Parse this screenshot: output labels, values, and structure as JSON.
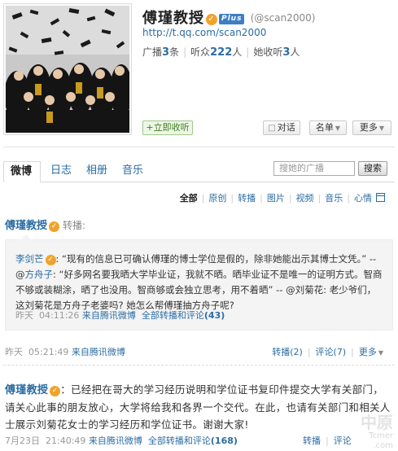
{
  "profile": {
    "name": "傅瑾教授",
    "vip_badge": "Plus",
    "handle": "(@scan2000)",
    "url": "http://t.qq.com/scan2000",
    "stats": [
      {
        "label": "广播",
        "count": "3",
        "unit": "条"
      },
      {
        "label": "听众",
        "count": "222",
        "unit": "人"
      },
      {
        "label": "她收听",
        "count": "3",
        "unit": "人"
      }
    ],
    "listen_label": "+立即收听",
    "chat_label": "对话",
    "namecard_label": "名单",
    "more_label": "更多"
  },
  "tabs": [
    "微博",
    "日志",
    "相册",
    "音乐"
  ],
  "search": {
    "placeholder": "搜她的广播",
    "button": "搜索"
  },
  "filters": [
    "全部",
    "原创",
    "转播",
    "图片",
    "视频",
    "音乐",
    "心情"
  ],
  "post1": {
    "author": "傅瑾教授",
    "action": "转播:",
    "repost": {
      "user1": "李剑芒",
      "quote1": ": “现有的信息已可确认傅瑾的博士学位是假的，除非她能出示其博士文凭。” -- @",
      "user2": "方舟子",
      "quote2": ": “好多网名要我晒大学毕业证，我就不晒。晒毕业证不是唯一的证明方式。智商不够或装糊涂，晒了也没用。智商够或会独立思考，用不着晒” -- @刘菊花: 老少爷们，这刘菊花是方舟子老婆吗? 她怎么帮傅瑾抽方舟子呢?",
      "time": "昨天",
      "clock": "04:11:26",
      "source": "来自腾讯微博",
      "all_label": "全部转播和评论",
      "all_count": "(43)"
    },
    "time": "昨天",
    "clock": "05:21:49",
    "source": "来自腾讯微博",
    "repost_label": "转播(2)",
    "comment_label": "评论(7)",
    "more_label": "更多"
  },
  "post2": {
    "author": "傅瑾教授",
    "text": "：已经把在哥大的学习经历说明和学位证书复印件提交大学有关部门，请关心此事的朋友放心，大学将给我和各界一个交代。在此，也请有关部门和相关人士展示刘菊花女士的学习经历和学位证书。谢谢大家!",
    "time": "7月23日",
    "clock": "21:40:49",
    "source": "来自腾讯微博",
    "all_label": "全部转播和评论",
    "all_count": "(168)",
    "repost_label": "转播",
    "comment_label": "评论"
  },
  "watermark": {
    "big": "中原",
    "small": "Tcmer\n.com"
  },
  "colors": {
    "link": "#2b6ca3",
    "badge": "#f0a32c",
    "listen": "#3e7a1f"
  }
}
